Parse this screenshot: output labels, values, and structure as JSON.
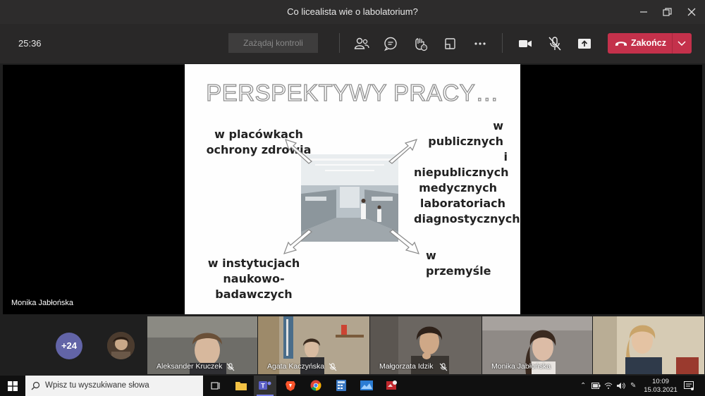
{
  "window": {
    "title": "Co licealista wie o labolatorium?"
  },
  "toolbar": {
    "timer": "25:36",
    "request_control_label": "Zażądaj kontroli",
    "end_call_label": "Zakończ"
  },
  "slide": {
    "title": "PERSPEKTYWY PRACY…",
    "top_left": [
      "w placówkach",
      "ochrony zdrowia"
    ],
    "top_right": [
      "w publicznych",
      "i niepublicznych",
      "medycznych",
      "laboratoriach",
      "diagnostycznych"
    ],
    "bottom_left": [
      "w instytucjach",
      "naukowo-badawczych"
    ],
    "bottom_right": [
      "w przemyśle"
    ]
  },
  "stage": {
    "presenter_name": "Monika Jabłońska"
  },
  "participants": {
    "more_count": "+24",
    "tiles": [
      {
        "name": "Aleksander Kruczek",
        "muted": true
      },
      {
        "name": "Agata Kaczyńska",
        "muted": true
      },
      {
        "name": "Małgorzata Idzik",
        "muted": true
      },
      {
        "name": "Monika Jabłońska",
        "muted": false
      },
      {
        "name": "",
        "muted": false
      }
    ]
  },
  "taskbar": {
    "search_placeholder": "Wpisz tu wyszukiwane słowa",
    "time": "10:09",
    "date": "15.03.2021"
  },
  "colors": {
    "end_call": "#c4314b",
    "more_badge": "#6264a7",
    "taskbar": "#101010"
  },
  "icons": [
    "participants-icon",
    "chat-icon",
    "reactions-icon",
    "rooms-icon",
    "more-icon",
    "camera-icon",
    "mic-off-icon",
    "share-icon",
    "hangup-icon",
    "chevron-down-icon"
  ]
}
